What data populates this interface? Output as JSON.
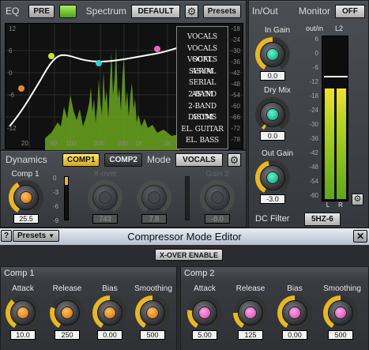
{
  "eq": {
    "title": "EQ",
    "pre_label": "PRE",
    "spectrum_label": "Spectrum",
    "spectrum_value": "DEFAULT",
    "presets_label": "Presets",
    "y_left": [
      "12",
      "6",
      "0",
      "-6",
      "-12"
    ],
    "y_right": [
      "-18",
      "-24",
      "-30",
      "-36",
      "-42",
      "-48",
      "-54",
      "-60",
      "-66",
      "-72",
      "-78"
    ],
    "x_ticks": [
      "20",
      "60",
      "100",
      "300",
      "600",
      "1K",
      "3K"
    ]
  },
  "mode_list": [
    "VOCALS",
    "VOCALS SOFT",
    "VOCALS ASYM",
    "SERIAL",
    "SERIAL ASYM",
    "2-BAND",
    "2-BAND ASYM",
    "DRUMS",
    "EL. GUITAR",
    "EL. BASS"
  ],
  "inout": {
    "title": "In/Out",
    "monitor_label": "Monitor",
    "monitor_value": "OFF",
    "in_gain_label": "In Gain",
    "in_gain_value": "0.0",
    "dry_mix_label": "Dry Mix",
    "dry_mix_value": "0.0",
    "out_gain_label": "Out Gain",
    "out_gain_value": "-3.0",
    "meter_header_a": "out/in",
    "meter_header_b": "L2",
    "meter_scale": [
      "6",
      "0",
      "-6",
      "-12",
      "-18",
      "-24",
      "-30",
      "-36",
      "-42",
      "-48",
      "-54",
      "-60"
    ],
    "meter_l": "L",
    "meter_r": "R",
    "dc_filter_label": "DC Filter",
    "dc_filter_value": "5HZ-6"
  },
  "dynamics": {
    "title": "Dynamics",
    "comp1_btn": "COMP1",
    "comp2_btn": "COMP2",
    "mode_label": "Mode",
    "mode_value": "VOCALS",
    "comp1_label": "Comp 1",
    "comp1_value": "25.5",
    "meter_scale": [
      "0",
      "-3",
      "-6",
      "-9"
    ],
    "xover_label": "X-over",
    "xover_value": "743",
    "gain2_label": "Gain 2",
    "gain2_value": "-8.0",
    "comp2_value": "7.8"
  },
  "editor": {
    "help": "?",
    "presets_label": "Presets",
    "title": "Compressor Mode Editor",
    "close": "✕",
    "xover_enable": "X-OVER ENABLE",
    "comp1": {
      "title": "Comp 1",
      "knobs": [
        {
          "label": "Attack",
          "value": "10.0"
        },
        {
          "label": "Release",
          "value": "250"
        },
        {
          "label": "Bias",
          "value": "0.00"
        },
        {
          "label": "Smoothing",
          "value": "500"
        }
      ]
    },
    "comp2": {
      "title": "Comp 2",
      "knobs": [
        {
          "label": "Attack",
          "value": "5.00"
        },
        {
          "label": "Release",
          "value": "125"
        },
        {
          "label": "Bias",
          "value": "0.00"
        },
        {
          "label": "Smoothing",
          "value": "500"
        }
      ]
    }
  },
  "colors": {
    "accent_yellow": "#e9b81f",
    "eq_curve": "#ffffff",
    "spectrum_fill": "#6aa51e",
    "knob_orange": "#e88b1c",
    "knob_green": "#1fc79a",
    "knob_pink": "#e867c5",
    "knob_disabled": "#4a4c50"
  },
  "icons": [
    "gear-icon",
    "close-icon",
    "chevron-down-icon",
    "help-icon"
  ]
}
